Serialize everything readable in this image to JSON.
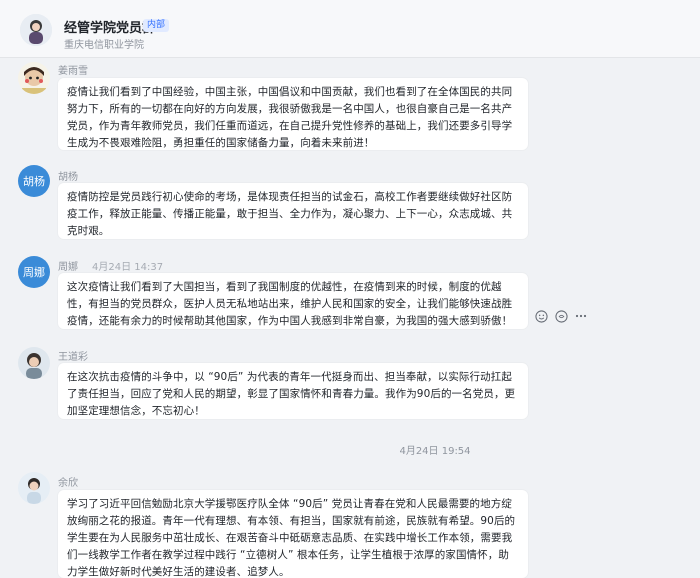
{
  "header": {
    "title": "经管学院党员群",
    "badge": "内部",
    "subtitle": "重庆电信职业学院"
  },
  "messages": [
    {
      "sender": "姜雨雪",
      "time": "",
      "avatar_text": "",
      "text": "疫情让我们看到了中国经验，中国主张，中国倡议和中国贡献，我们也看到了在全体国民的共同努力下，所有的一切都在向好的方向发展，我很骄傲我是一名中国人，也很自豪自己是一名共产党员，作为青年教师党员，我们任重而道远，在自己提升党性修养的基础上，我们还要多引导学生成为不畏艰难险阻，勇担重任的国家储备力量，向着未来前进！"
    },
    {
      "sender": "胡杨",
      "time": "",
      "avatar_text": "胡杨",
      "text": "疫情防控是党员践行初心使命的考场，是体现责任担当的试金石，高校工作者要继续做好社区防疫工作，释放正能量、传播正能量，敢于担当、全力作为，凝心聚力、上下一心，众志成城、共克时艰。"
    },
    {
      "sender": "周娜",
      "time": "4月24日 14:37",
      "avatar_text": "周娜",
      "text": "这次疫情让我们看到了大国担当，看到了我国制度的优越性，在疫情到来的时候，制度的优越性，有担当的党员群众，医护人员无私地站出来，维护人民和国家的安全，让我们能够快速战胜疫情，还能有余力的时候帮助其他国家，作为中国人我感到非常自豪，为我国的强大感到骄傲！"
    },
    {
      "sender": "王道彩",
      "time": "",
      "avatar_text": "",
      "text": "在这次抗击疫情的斗争中，以 “90后” 为代表的青年一代挺身而出、担当奉献，以实际行动扛起了责任担当，回应了党和人民的期望，彰显了国家情怀和青春力量。我作为90后的一名党员，更加坚定理想信念，不忘初心！"
    },
    {
      "sender": "余欣",
      "time": "",
      "avatar_text": "",
      "text": "学习了习近平回信勉励北京大学援鄂医疗队全体 “90后” 党员让青春在党和人民最需要的地方绽放绚丽之花的报道。青年一代有理想、有本领、有担当，国家就有前途，民族就有希望。90后的学生要在为人民服务中茁壮成长、在艰苦奋斗中砥砺意志品质、在实践中增长工作本领，需要我们一线教学工作者在教学过程中践行 “立德树人” 根本任务，让学生植根于浓厚的家国情怀，助力学生做好新时代美好生活的建设者、追梦人。"
    }
  ],
  "divider_time": "4月24日 19:54",
  "colors": {
    "accent": "#3370ff",
    "avatar_blue": "#3a8bd8",
    "background": "#f0f2f5"
  },
  "icons": [
    "emoji-reaction-icon",
    "reply-icon",
    "more-icon"
  ]
}
